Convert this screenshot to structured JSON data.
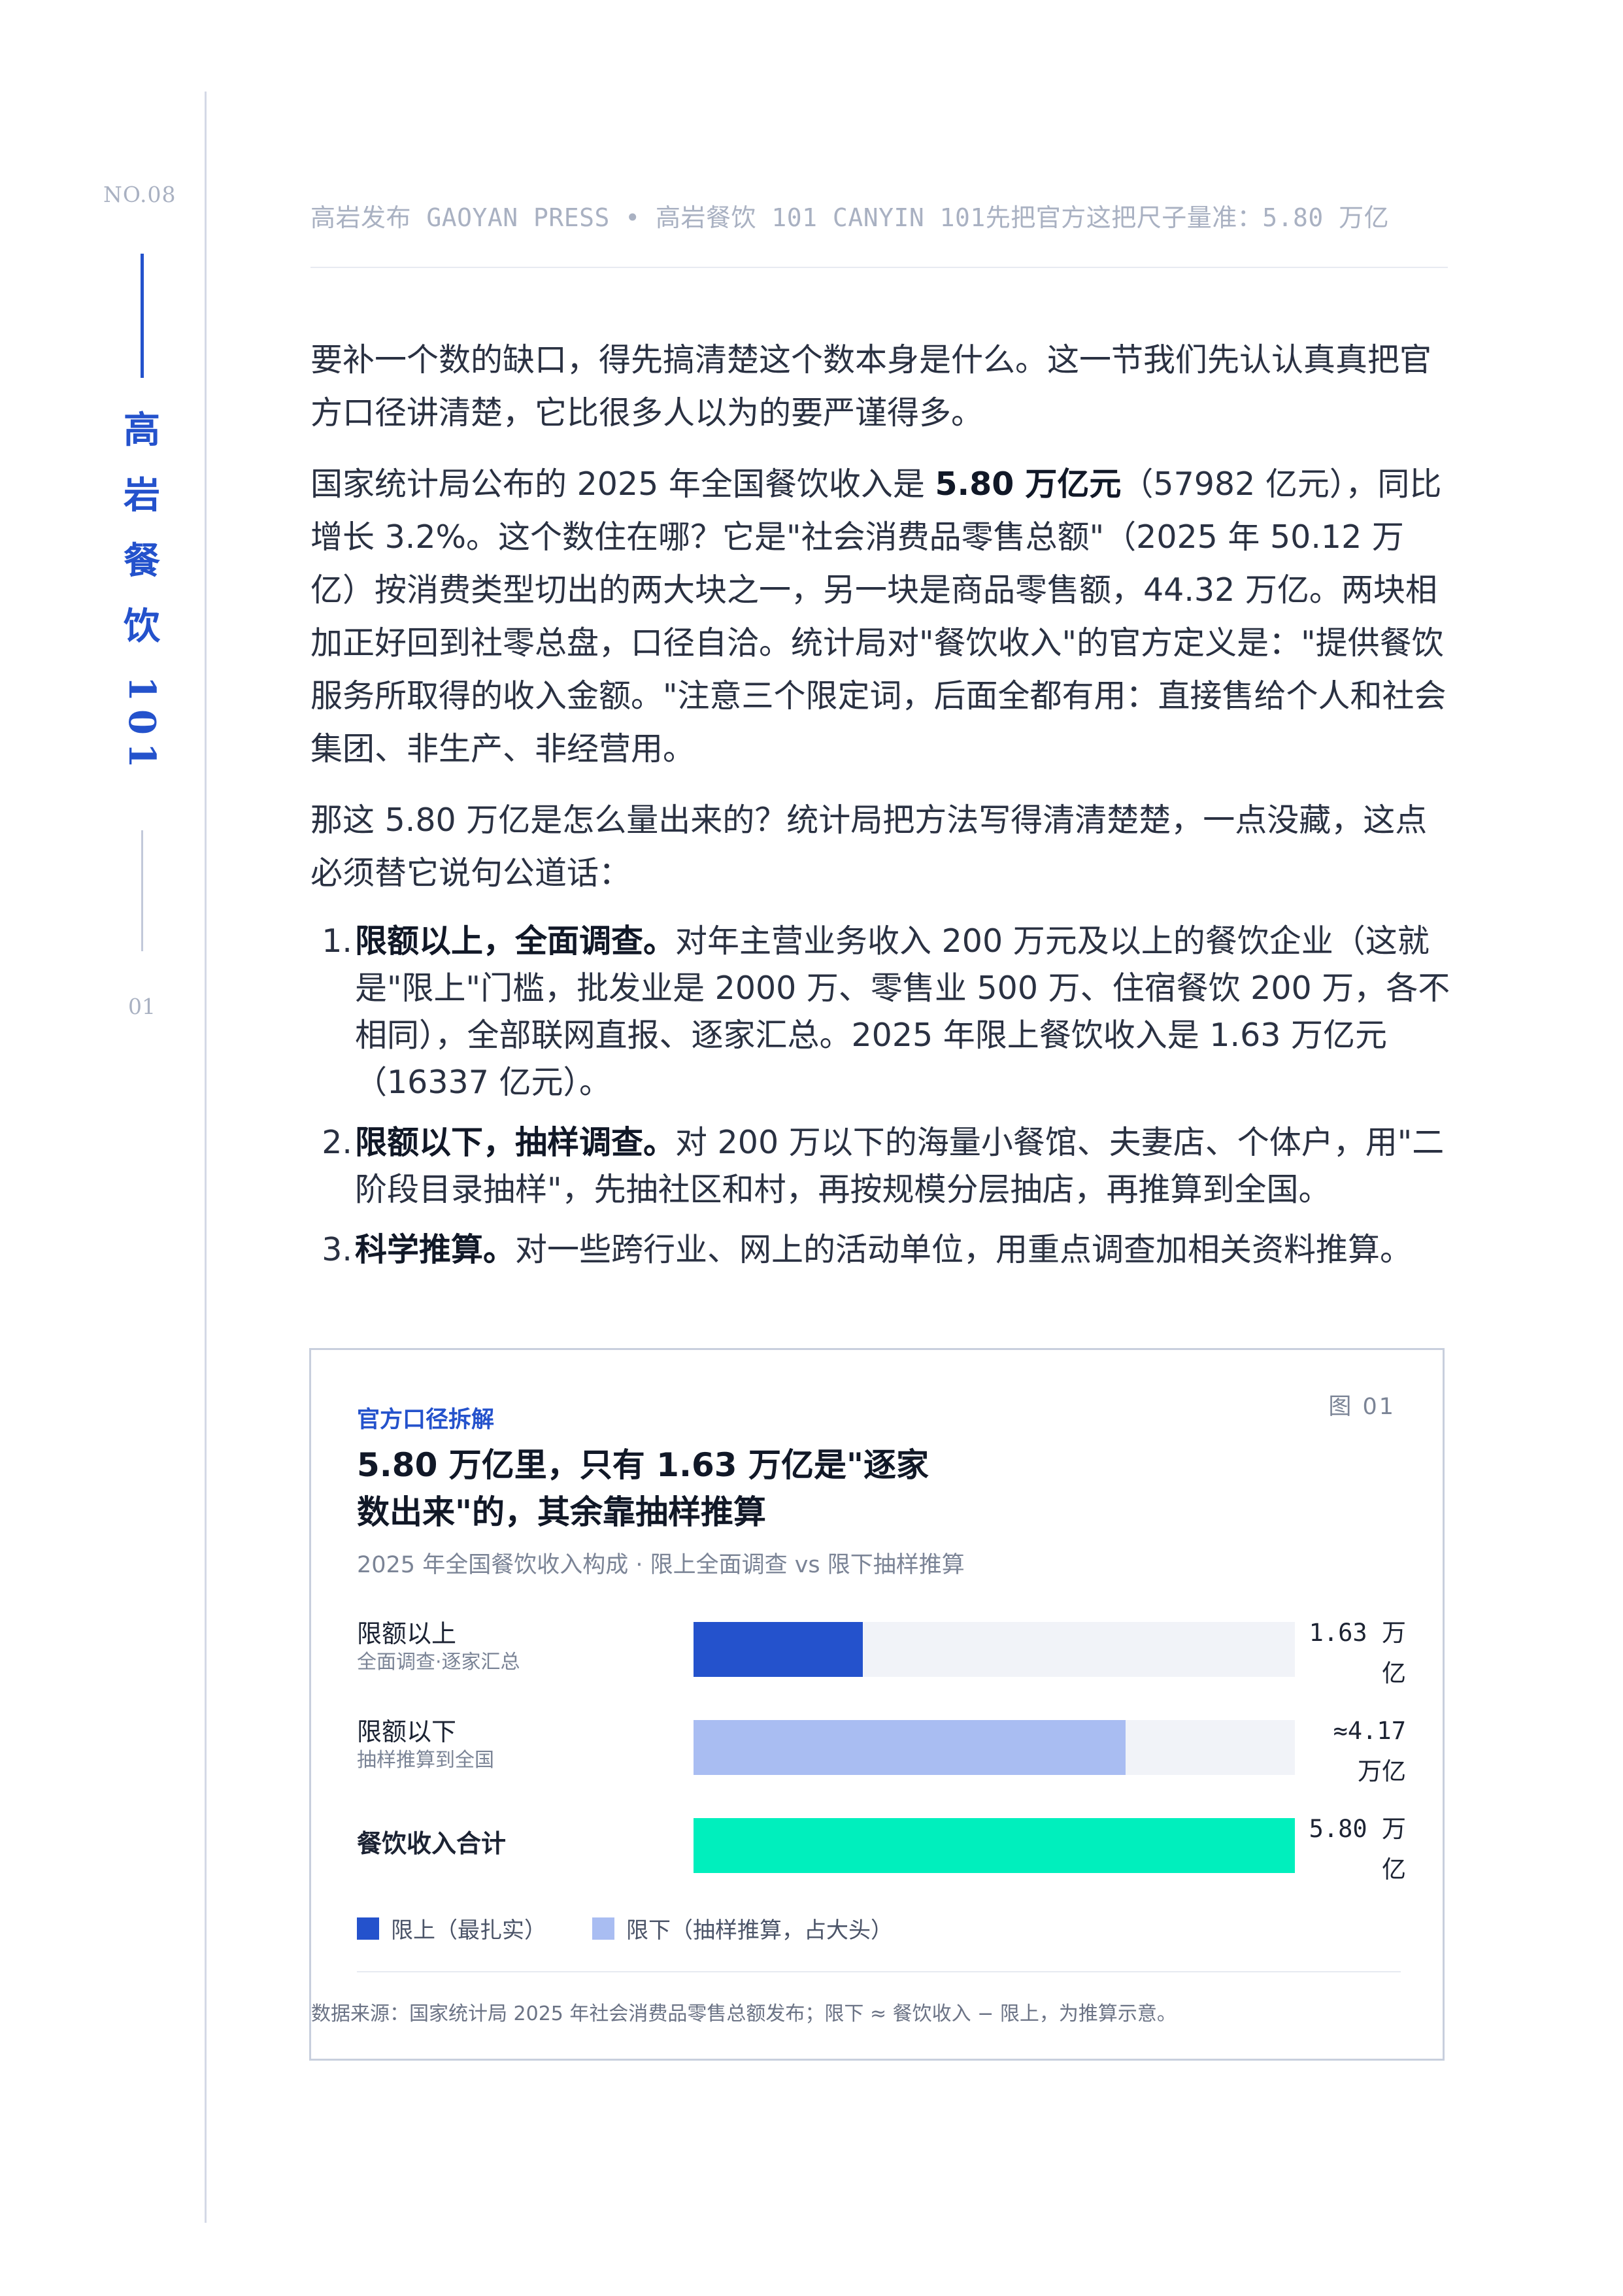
{
  "rail": {
    "issue_no": "NO.08",
    "brand_chars": [
      "高",
      "岩",
      "餐",
      "饮"
    ],
    "brand_num": "101",
    "page_no": "01"
  },
  "header": {
    "running_title": "高岩发布 GAOYAN PRESS • 高岩餐饮 101 CANYIN 101先把官方这把尺子量准：5.80 万亿"
  },
  "body": {
    "p1": "要补一个数的缺口，得先搞清楚这个数本身是什么。这一节我们先认认真真把官方口径讲清楚，它比很多人以为的要严谨得多。",
    "p2_pre": "国家统计局公布的 2025 年全国餐饮收入是 ",
    "p2_bold": "5.80 万亿元",
    "p2_post": "（57982 亿元），同比增长 3.2%。这个数住在哪？它是\"社会消费品零售总额\"（2025 年 50.12 万亿）按消费类型切出的两大块之一，另一块是商品零售额，44.32 万亿。两块相加正好回到社零总盘，口径自洽。统计局对\"餐饮收入\"的官方定义是：\"提供餐饮服务所取得的收入金额。\"注意三个限定词，后面全都有用：直接售给个人和社会集团、非生产、非经营用。",
    "p3": "那这 5.80 万亿是怎么量出来的？统计局把方法写得清清楚楚，一点没藏，这点必须替它说句公道话：",
    "list": [
      {
        "num": "1.",
        "bold": "限额以上，全面调查。",
        "text": "对年主营业务收入 200 万元及以上的餐饮企业（这就是\"限上\"门槛，批发业是 2000 万、零售业 500 万、住宿餐饮 200 万，各不相同），全部联网直报、逐家汇总。2025 年限上餐饮收入是 1.63 万亿元（16337 亿元）。"
      },
      {
        "num": "2.",
        "bold": "限额以下，抽样调查。",
        "text": "对 200 万以下的海量小餐馆、夫妻店、个体户，用\"二阶段目录抽样\"，先抽社区和村，再按规模分层抽店，再推算到全国。"
      },
      {
        "num": "3.",
        "bold": "科学推算。",
        "text": "对一些跨行业、网上的活动单位，用重点调查加相关资料推算。"
      }
    ]
  },
  "figure": {
    "kicker": "官方口径拆解",
    "fig_label": "图 01",
    "title": "5.80 万亿里，只有 1.63 万亿是\"逐家数出来\"的，其余靠抽样推算",
    "subtitle": "2025 年全国餐饮收入构成 · 限上全面调查 vs 限下抽样推算",
    "legend": [
      {
        "label": "限上（最扎实）",
        "color": "#2452cc"
      },
      {
        "label": "限下（抽样推算，占大头）",
        "color": "#a9bdf2"
      }
    ],
    "source": "数据来源：国家统计局 2025 年社会消费品零售总额发布；限下 ≈ 餐饮收入 − 限上，为推算示意。"
  },
  "chart_data": {
    "type": "bar",
    "orientation": "horizontal",
    "unit": "万亿",
    "categories": [
      "限额以上",
      "限额以下",
      "餐饮收入合计"
    ],
    "category_notes": [
      "全面调查·逐家汇总",
      "抽样推算到全国",
      ""
    ],
    "values": [
      1.63,
      4.17,
      5.8
    ],
    "value_labels": [
      "1.63 万亿",
      "≈4.17 万亿",
      "5.80 万亿"
    ],
    "colors": [
      "#2452cc",
      "#a9bdf2",
      "#00efbd"
    ],
    "xlim": [
      0,
      5.8
    ],
    "grid": false,
    "legend_position": "bottom-left"
  }
}
